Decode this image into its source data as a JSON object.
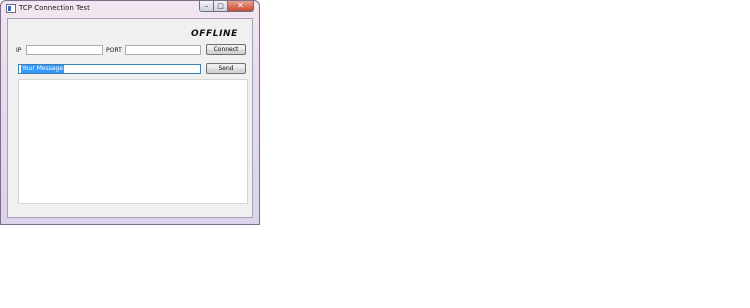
{
  "window": {
    "title": "TCP Connection Test",
    "minimize_glyph": "–",
    "maximize_glyph": "□",
    "close_glyph": "✕"
  },
  "status": {
    "text": "OFFLINE"
  },
  "connection": {
    "ip_label": "IP",
    "ip_value": "",
    "port_label": "PORT",
    "port_value": "",
    "connect_label": "Connect"
  },
  "message": {
    "value": "Your Message",
    "send_label": "Send"
  },
  "log": {
    "text": ""
  }
}
